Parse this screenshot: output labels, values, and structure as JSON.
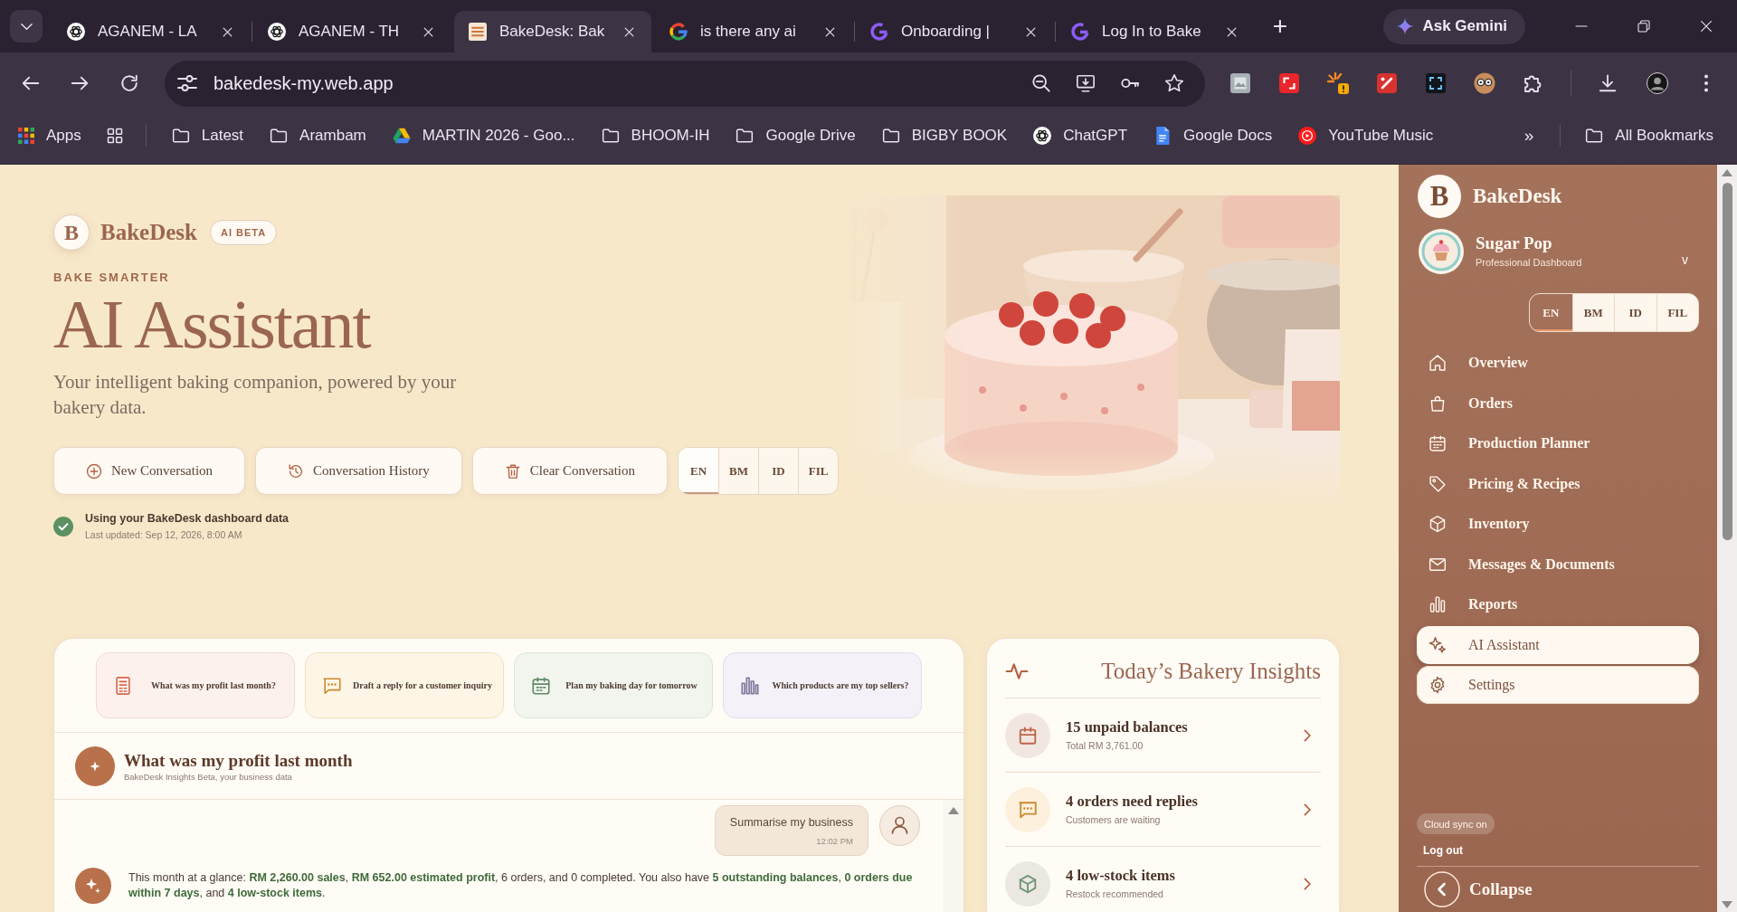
{
  "browser": {
    "tabs": [
      {
        "title": "AGANEM - LA",
        "kind": "assistant",
        "selected": false
      },
      {
        "title": "AGANEM - TH",
        "kind": "assistant",
        "selected": false
      },
      {
        "title": "BakeDesk: Bak",
        "kind": "bakery",
        "selected": true
      },
      {
        "title": "is there any ai",
        "kind": "search",
        "selected": false
      },
      {
        "title": "Onboarding |",
        "kind": "workspace",
        "selected": false
      },
      {
        "title": "Log In to Bake",
        "kind": "workspace",
        "selected": false
      }
    ],
    "new_tab": "+",
    "assistant_button": "Ask Gemini",
    "url": "bakedesk-my.web.app",
    "apps": "Apps",
    "bookmarks": [
      {
        "label": "Latest",
        "kind": "folder"
      },
      {
        "label": "Arambam",
        "kind": "folder"
      },
      {
        "label": "MARTIN 2026 - Goo...",
        "kind": "drive"
      },
      {
        "label": "BHOOM-IH",
        "kind": "folder"
      },
      {
        "label": "Google Drive",
        "kind": "folder"
      },
      {
        "label": "BIGBY BOOK",
        "kind": "folder"
      },
      {
        "label": "ChatGPT",
        "kind": "assistant"
      },
      {
        "label": "Google Docs",
        "kind": "docs"
      },
      {
        "label": "YouTube Music",
        "kind": "music"
      }
    ],
    "overflow": "»",
    "all_bookmarks": "All Bookmarks"
  },
  "hero": {
    "logo_letter": "B",
    "brand": "BakeDesk",
    "badge": "AI BETA",
    "eyebrow": "BAKE SMARTER",
    "title": "AI Assistant",
    "subtitle": "Your intelligent baking companion, powered by your bakery data.",
    "actions": [
      {
        "label": "New Conversation",
        "kind": "new"
      },
      {
        "label": "Conversation History",
        "kind": "history"
      },
      {
        "label": "Clear Conversation",
        "kind": "clear"
      }
    ],
    "languages": [
      {
        "label": "EN",
        "selected": true
      },
      {
        "label": "BM",
        "selected": false
      },
      {
        "label": "ID",
        "selected": false
      },
      {
        "label": "FIL",
        "selected": false
      }
    ],
    "data_source": {
      "connected": true,
      "title": "Using your BakeDesk dashboard data",
      "updated": "Last updated: Sep 12, 2026, 8:00 AM"
    }
  },
  "chat": {
    "suggestions": [
      {
        "label": "What was my profit last month?",
        "kind": "profit"
      },
      {
        "label": "Draft a reply for a customer inquiry",
        "kind": "reply"
      },
      {
        "label": "Plan my baking day for tomorrow",
        "kind": "plan"
      },
      {
        "label": "Which products are my top sellers?",
        "kind": "sellers"
      }
    ],
    "conversation": {
      "title": "What was my profit last month",
      "subtitle": "BakeDesk Insights Beta, your business data"
    },
    "messages": [
      {
        "kind": "user",
        "text": "Summarise my business",
        "time": "12:02 PM"
      },
      {
        "kind": "assistant",
        "text": "This month at a glance: **RM 2,260.00 sales**, **RM 652.00 estimated profit**, 6 orders, and 0 completed. You also have **5 outstanding balances**, **0 orders due within 7 days**, and **4 low-stock items**."
      }
    ]
  },
  "insights": {
    "title": "Today’s Bakery Insights",
    "items": [
      {
        "kind": "balances",
        "title": "15 unpaid balances",
        "detail": "Total RM 3,761.00"
      },
      {
        "kind": "replies",
        "title": "4 orders need replies",
        "detail": "Customers are waiting"
      },
      {
        "kind": "stock",
        "title": "4 low-stock items",
        "detail": "Restock recommended"
      }
    ]
  },
  "sidebar": {
    "logo_letter": "B",
    "brand": "BakeDesk",
    "profile": {
      "name": "Sugar Pop",
      "role": "Professional Dashboard",
      "toggle": "v"
    },
    "languages": [
      {
        "label": "EN",
        "selected": true
      },
      {
        "label": "BM",
        "selected": false
      },
      {
        "label": "ID",
        "selected": false
      },
      {
        "label": "FIL",
        "selected": false
      }
    ],
    "nav": [
      {
        "label": "Overview",
        "kind": "home",
        "selected": false,
        "hovered": false
      },
      {
        "label": "Orders",
        "kind": "orders",
        "selected": false,
        "hovered": false
      },
      {
        "label": "Production Planner",
        "kind": "planner",
        "selected": false,
        "hovered": false
      },
      {
        "label": "Pricing & Recipes",
        "kind": "pricing",
        "selected": false,
        "hovered": false
      },
      {
        "label": "Inventory",
        "kind": "inventory",
        "selected": false,
        "hovered": false
      },
      {
        "label": "Messages & Documents",
        "kind": "messages",
        "selected": false,
        "hovered": false
      },
      {
        "label": "Reports",
        "kind": "reports",
        "selected": false,
        "hovered": false
      },
      {
        "label": "AI Assistant",
        "kind": "assistant",
        "selected": true,
        "hovered": false
      },
      {
        "label": "Settings",
        "kind": "settings",
        "selected": false,
        "hovered": true
      }
    ],
    "sync": "Cloud sync on",
    "logout": "Log out",
    "collapse": "Collapse"
  }
}
